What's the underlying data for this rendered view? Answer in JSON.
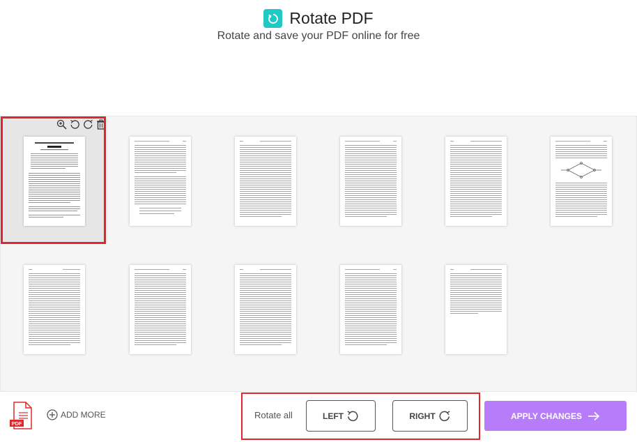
{
  "header": {
    "title": "Rotate PDF",
    "subtitle": "Rotate and save your PDF online for free",
    "logo_icon": "rotate-icon",
    "accent_color": "#1fc9c4"
  },
  "thumbnail_tools": {
    "icons": [
      "zoom-in-icon",
      "rotate-left-icon",
      "rotate-right-icon",
      "trash-icon"
    ]
  },
  "pages": [
    {
      "page": 1,
      "selected": true
    },
    {
      "page": 2,
      "selected": false
    },
    {
      "page": 3,
      "selected": false
    },
    {
      "page": 4,
      "selected": false
    },
    {
      "page": 5,
      "selected": false
    },
    {
      "page": 6,
      "selected": false
    },
    {
      "page": 7,
      "selected": false
    },
    {
      "page": 8,
      "selected": false
    },
    {
      "page": 9,
      "selected": false
    },
    {
      "page": 10,
      "selected": false
    },
    {
      "page": 11,
      "selected": false
    }
  ],
  "footer": {
    "file_icon_label": "PDF",
    "add_more_label": "ADD MORE",
    "rotate_all_label": "Rotate all",
    "left_label": "LEFT",
    "right_label": "RIGHT",
    "apply_label": "APPLY CHANGES",
    "apply_color": "#b77cf9",
    "highlight_color": "#e0262a"
  }
}
